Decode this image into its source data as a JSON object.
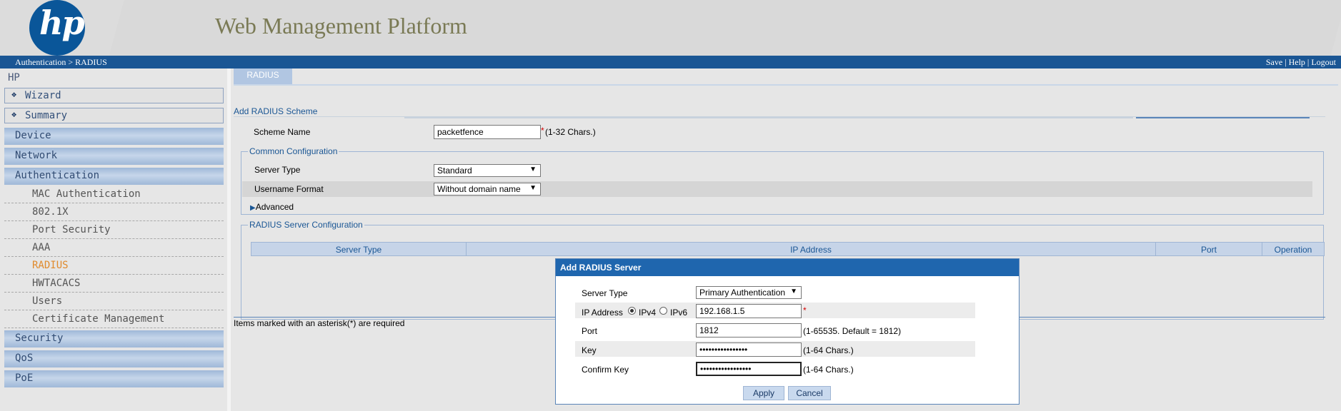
{
  "header": {
    "logo_text": "hp",
    "app_title": "Web Management Platform",
    "breadcrumb": "Authentication > RADIUS",
    "links": {
      "save": "Save",
      "sep1": " | ",
      "help": "Help",
      "sep2": " | ",
      "logout": "Logout"
    }
  },
  "sidebar": {
    "root": "HP",
    "boxed_items": [
      {
        "label": "Wizard"
      },
      {
        "label": "Summary"
      }
    ],
    "categories": {
      "device": "Device",
      "network": "Network",
      "authentication": "Authentication",
      "security": "Security",
      "qos": "QoS",
      "poe": "PoE"
    },
    "auth_sub_items": [
      {
        "label": "MAC Authentication"
      },
      {
        "label": "802.1X"
      },
      {
        "label": "Port Security"
      },
      {
        "label": "AAA"
      },
      {
        "label": "RADIUS",
        "active": true
      },
      {
        "label": "HWTACACS"
      },
      {
        "label": "Users"
      },
      {
        "label": "Certificate Management"
      }
    ]
  },
  "main": {
    "tab": "RADIUS",
    "section_title": "Add RADIUS Scheme",
    "scheme_name": {
      "label": "Scheme Name",
      "value": "packetfence",
      "required": "*",
      "hint": "(1-32 Chars.)"
    },
    "common_config": {
      "legend": "Common Configuration",
      "server_type": {
        "label": "Server Type",
        "value": "Standard"
      },
      "username_format": {
        "label": "Username Format",
        "value": "Without domain name"
      },
      "advanced": "Advanced"
    },
    "server_config": {
      "legend": "RADIUS Server Configuration",
      "columns": {
        "server_type": "Server Type",
        "ip_address": "IP Address",
        "port": "Port",
        "operation": "Operation"
      }
    },
    "required_note": "Items marked with an asterisk(*) are required"
  },
  "dialog": {
    "title": "Add RADIUS Server",
    "server_type": {
      "label": "Server Type",
      "value": "Primary Authentication"
    },
    "ip_address": {
      "label": "IP Address",
      "ipv4": "IPv4",
      "ipv6": "IPv6",
      "selected": "IPv4",
      "value": "192.168.1.5",
      "required": "*"
    },
    "port": {
      "label": "Port",
      "value": "1812",
      "hint": "(1-65535. Default = 1812)"
    },
    "key": {
      "label": "Key",
      "value": "••••••••••••••••",
      "hint": "(1-64 Chars.)"
    },
    "confirm_key": {
      "label": "Confirm Key",
      "value": "•••••••••••••••••",
      "hint": "(1-64 Chars.)"
    },
    "apply": "Apply",
    "cancel": "Cancel"
  },
  "colors": {
    "nav_bar": "#1a5694",
    "logo_blue": "#0a5699",
    "sidebar_category": "#9fb8d8",
    "active_item": "#e08a2c",
    "dialog_title": "#1f66ae",
    "required_star": "#d40000"
  },
  "icons": {
    "bullet": "diamond-bullet-icon",
    "expand": "triangle-right-icon",
    "dropdown": "triangle-down-icon"
  }
}
